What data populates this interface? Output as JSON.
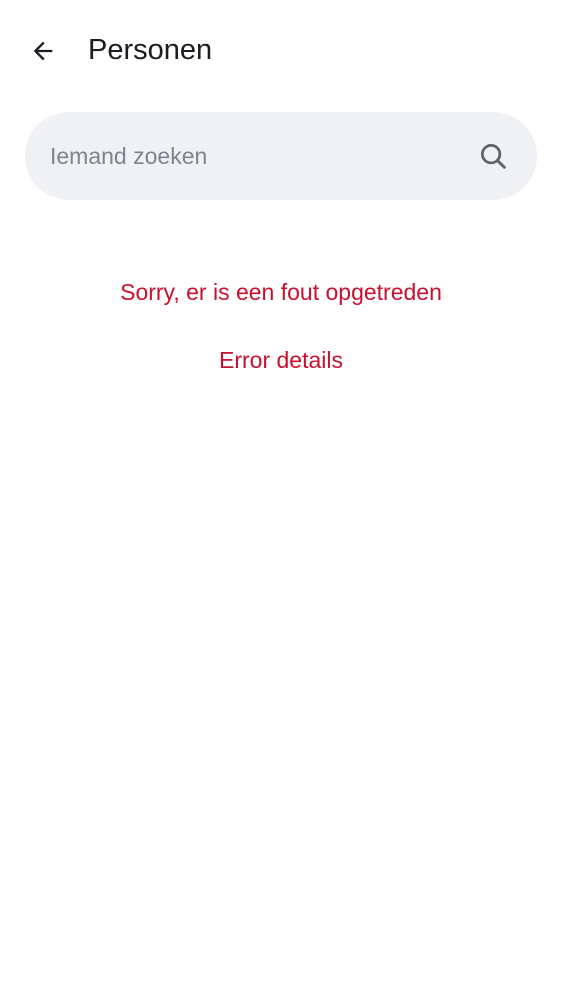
{
  "header": {
    "back_icon": "arrow-left-icon",
    "title": "Personen"
  },
  "search": {
    "placeholder": "Iemand zoeken",
    "value": "",
    "icon": "search-icon"
  },
  "error": {
    "message": "Sorry, er is een fout opgetreden",
    "details_label": "Error details",
    "color": "#c8102e"
  },
  "colors": {
    "background": "#ffffff",
    "search_background": "#eff1f5",
    "title_text": "#1b1c22",
    "placeholder_text": "#7f838d"
  }
}
